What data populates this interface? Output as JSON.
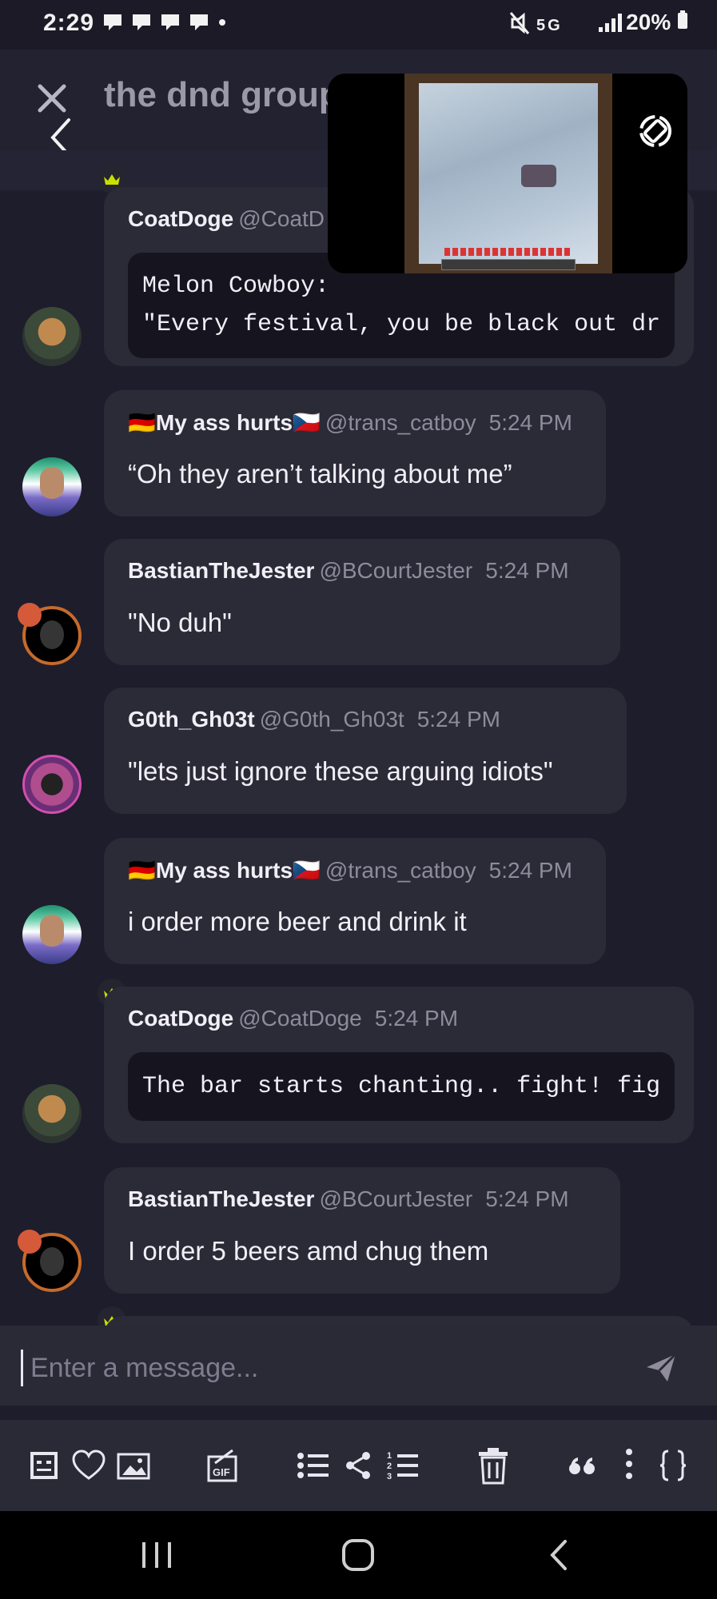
{
  "status_bar": {
    "time": "2:29",
    "battery": "20%",
    "network": "5G",
    "notification_icons": [
      "chat-icon",
      "chat-icon",
      "chat-icon",
      "chat-icon",
      "chat-icon",
      "dot-icon"
    ]
  },
  "header": {
    "title": "the dnd group",
    "close_icon": "close-icon",
    "back_icon": "back-arrow-icon"
  },
  "pip": {
    "rotate_icon": "rotate-icon"
  },
  "messages": [
    {
      "user": "CoatDoge",
      "handle": "@CoatD",
      "time": "",
      "crown": true,
      "code": [
        "Melon Cowboy:",
        "\"Every festival, you be black out dr"
      ]
    },
    {
      "user": "🇩🇪My ass hurts🇨🇿",
      "handle": "@trans_catboy",
      "time": "5:24 PM",
      "text": "“Oh they aren’t talking about me”"
    },
    {
      "user": "BastianTheJester",
      "handle": "@BCourtJester",
      "time": "5:24 PM",
      "text": "\"No duh\""
    },
    {
      "user": "G0th_Gh03t",
      "handle": "@G0th_Gh03t",
      "time": "5:24 PM",
      "text": "\"lets just ignore these arguing idiots\""
    },
    {
      "user": "🇩🇪My ass hurts🇨🇿",
      "handle": "@trans_catboy",
      "time": "5:24 PM",
      "text": "i order more beer and drink it"
    },
    {
      "user": "CoatDoge",
      "handle": "@CoatDoge",
      "time": "5:24 PM",
      "crown": true,
      "code": [
        "The bar starts chanting.. fight! fig"
      ]
    },
    {
      "user": "BastianTheJester",
      "handle": "@BCourtJester",
      "time": "5:24 PM",
      "text": "I order 5 beers amd chug them"
    }
  ],
  "input": {
    "placeholder": "Enter a message..."
  },
  "toolbar": {
    "items": [
      "emoji-icon",
      "heart-icon",
      "image-icon",
      "gif-icon",
      "bullet-list-icon",
      "share-icon",
      "numbered-list-icon",
      "trash-icon",
      "quote-icon",
      "more-icon",
      "code-braces-icon"
    ]
  },
  "colors": {
    "background": "#1e1d2b",
    "bubble": "#2b2a37",
    "code_block": "#16151f",
    "crown": "#c8e000",
    "muted_text": "#8e8b9b"
  }
}
